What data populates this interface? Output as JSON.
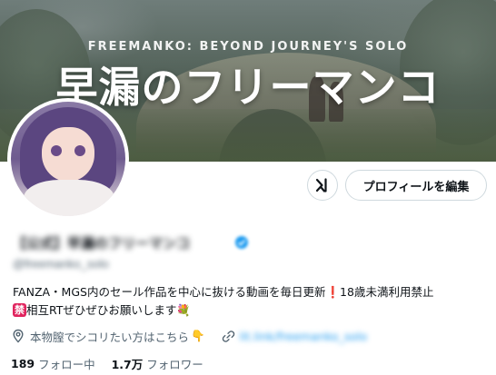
{
  "banner": {
    "subtitle": "FREEMANKO: BEYOND JOURNEY'S SOLO",
    "title": "早漏のフリーマンコ"
  },
  "actions": {
    "grok_icon": "grok-icon",
    "edit_profile_label": "プロフィールを編集"
  },
  "profile": {
    "display_name": "【公式】早漏のフリーマンコ",
    "handle": "@freemanko_solo",
    "verified_icon": "verified-badge-icon",
    "accent_color": "#1d9bf0"
  },
  "bio": {
    "line1_text": "FANZA・MGS内のセール作品を中心に抜ける動画を毎日更新",
    "line1_emoji": "❗",
    "line1_suffix": "18歳未満利用禁止",
    "line2_badge": "禁",
    "line2_text": "相互RTぜひぜひお願いします",
    "line2_emoji": "💐"
  },
  "meta": {
    "location_icon": "location-pin-icon",
    "location_text": "本物膣でシコリたい方はこちら",
    "location_emoji": "👇",
    "link_icon": "link-icon",
    "link_text": "lit.link/freemanko_solo"
  },
  "stats": {
    "following_count": "189",
    "following_label": "フォロー中",
    "followers_count": "1.7万",
    "followers_label": "フォロワー"
  }
}
